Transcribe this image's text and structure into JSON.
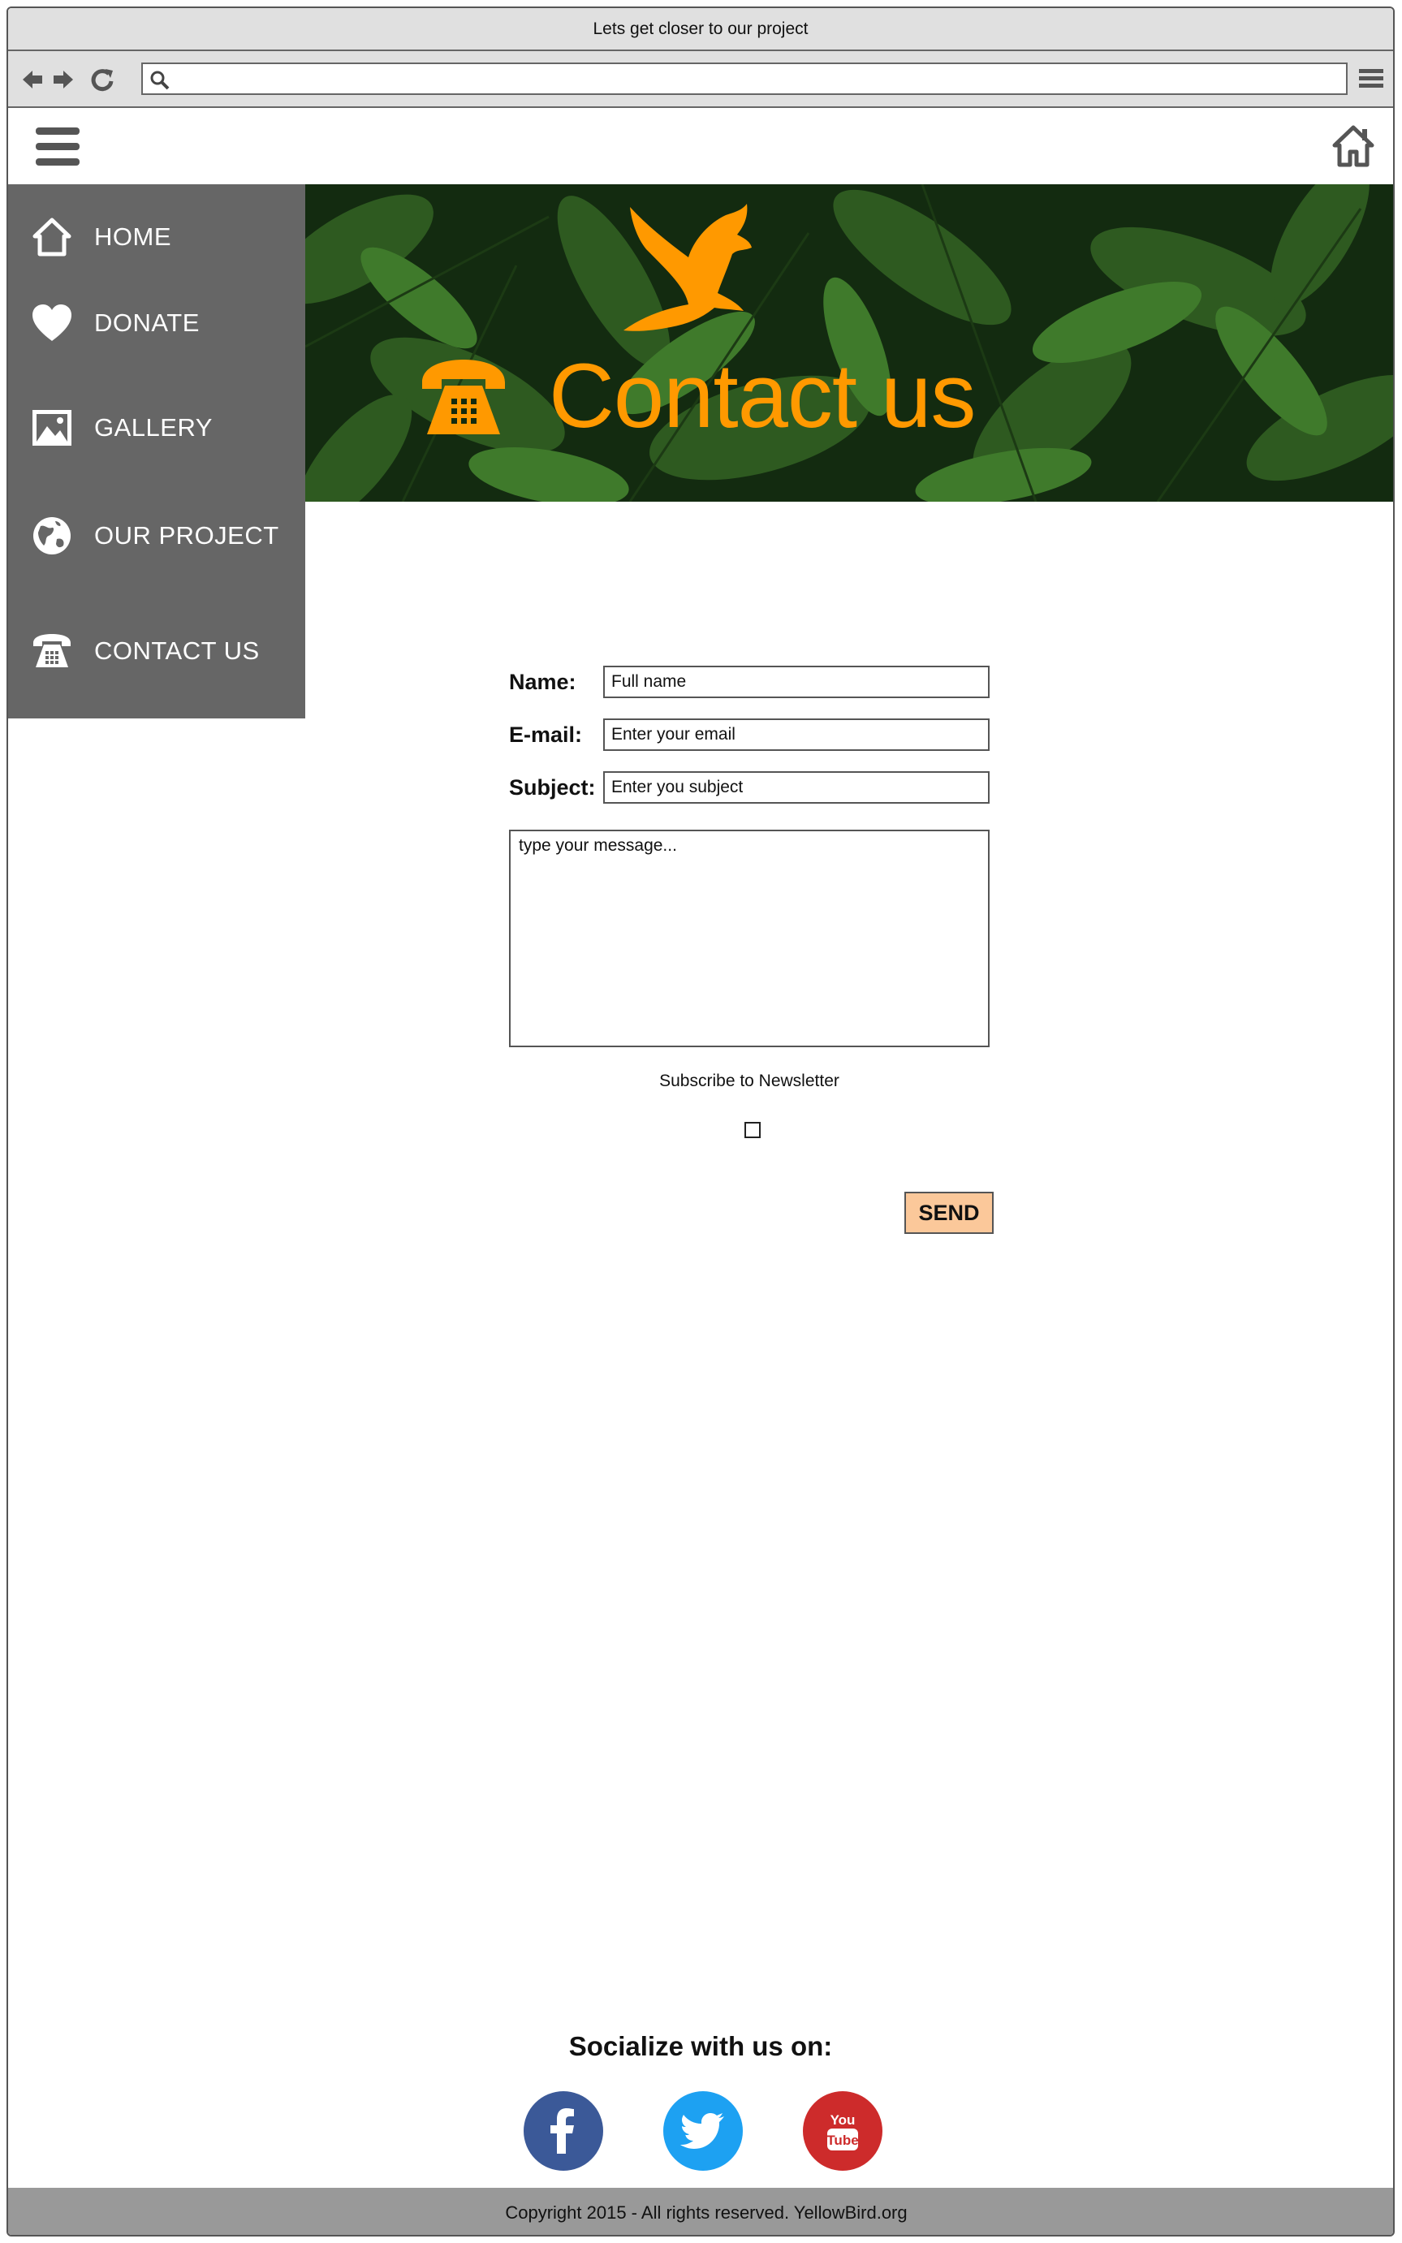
{
  "window": {
    "title": "Lets get closer to our project"
  },
  "browser": {
    "address_value": "",
    "icons": [
      "back-arrow-icon",
      "forward-arrow-icon",
      "reload-icon",
      "search-icon",
      "menu-icon"
    ]
  },
  "header": {
    "icons": [
      "hamburger-menu-icon",
      "home-icon"
    ]
  },
  "sidebar": {
    "items": [
      {
        "label": "HOME",
        "icon": "home-icon"
      },
      {
        "label": "DONATE",
        "icon": "heart-icon"
      },
      {
        "label": "GALLERY",
        "icon": "image-icon"
      },
      {
        "label": "OUR PROJECT",
        "icon": "globe-icon"
      },
      {
        "label": "CONTACT US",
        "icon": "telephone-icon"
      }
    ]
  },
  "hero": {
    "title": "Contact us",
    "icons": [
      "telephone-icon",
      "bird-icon"
    ]
  },
  "form": {
    "name_label": "Name:",
    "name_value": "Full name",
    "email_label": "E-mail:",
    "email_value": "Enter your email",
    "subject_label": "Subject:",
    "subject_value": "Enter you subject",
    "message_value": "type your message...",
    "subscribe_label": "Subscribe to Newsletter",
    "subscribe_checked": false,
    "send_label": "SEND"
  },
  "social": {
    "title": "Socialize with us on:",
    "links": [
      {
        "name": "facebook",
        "color": "#3b5998"
      },
      {
        "name": "twitter",
        "color": "#1da1f2"
      },
      {
        "name": "youtube",
        "color": "#cd2b2b"
      }
    ]
  },
  "colors": {
    "accent": "#ff9900",
    "sidebar": "#666666",
    "send_button": "#fbc89a",
    "footer": "#999999"
  },
  "footer": {
    "text": "Copyright 2015  - All rights reserved. YellowBird.org"
  }
}
